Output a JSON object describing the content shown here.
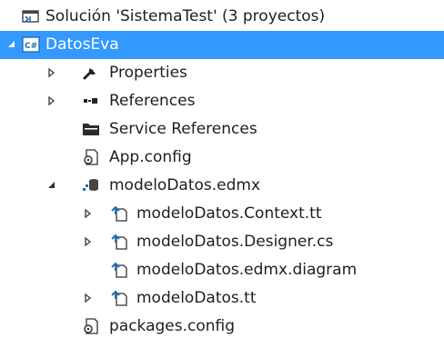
{
  "solution_explorer": {
    "solution_label": "Solución 'SistemaTest'  (3 proyectos)",
    "project_label": "DatosEva",
    "items": {
      "properties": "Properties",
      "references": "References",
      "service_references": "Service References",
      "app_config": "App.config",
      "edmx": "modeloDatos.edmx",
      "context_tt": "modeloDatos.Context.tt",
      "designer_cs": "modeloDatos.Designer.cs",
      "edmx_diagram": "modeloDatos.edmx.diagram",
      "modelo_tt": "modeloDatos.tt",
      "packages_config": "packages.config"
    },
    "icons": {
      "solution": "solution-icon",
      "csharp_project": "csharp-project-icon",
      "properties": "wrench-icon",
      "references": "references-icon",
      "service_references": "folder-icon",
      "config": "config-file-icon",
      "edmx": "edmx-model-icon",
      "tt": "text-template-icon"
    },
    "colors": {
      "selection": "#3399ff",
      "text": "#1e1e1e",
      "icon_blue": "#1e6fb3"
    }
  }
}
